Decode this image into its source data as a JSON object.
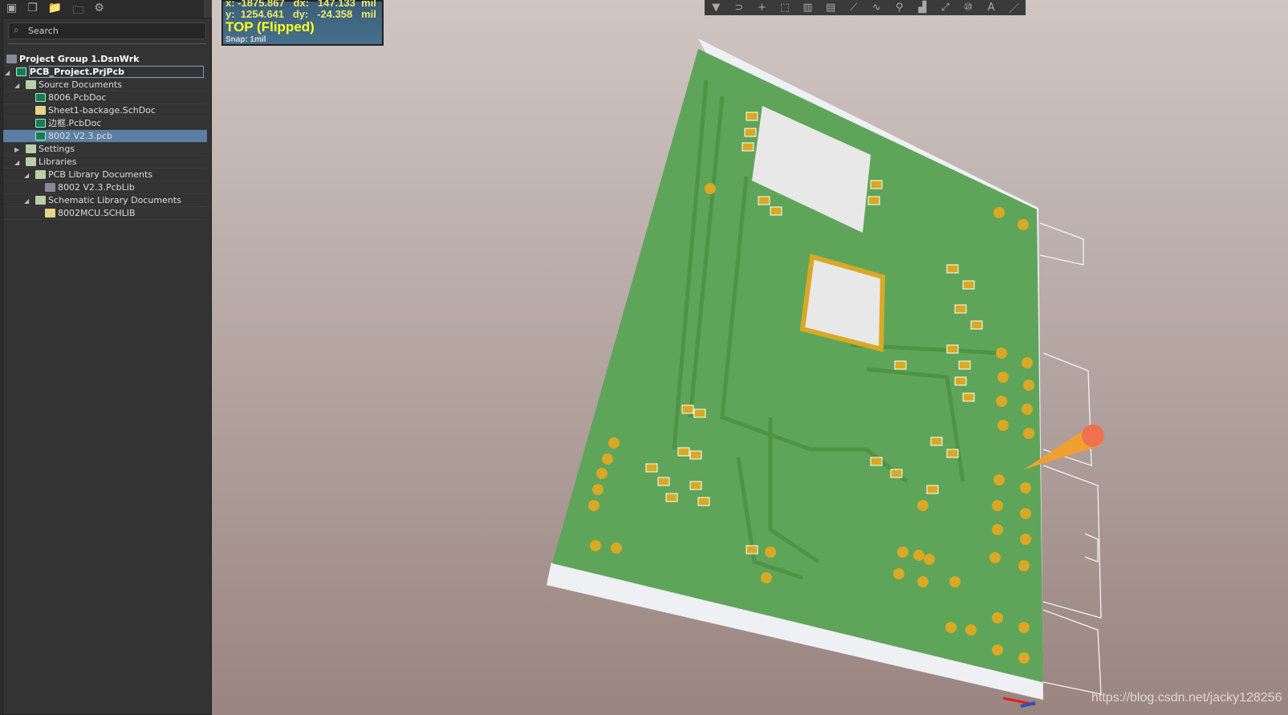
{
  "toolbar_left": {
    "icons": [
      "save-icon",
      "save-all-icon",
      "open-project-icon",
      "project-options-icon",
      "gear-icon"
    ]
  },
  "search": {
    "placeholder": "Search"
  },
  "tree": [
    {
      "label": "Project Group 1.DsnWrk",
      "level": 0,
      "icon": "workspace",
      "bold": true
    },
    {
      "label": "PCB_Project.PrjPcb",
      "level": 1,
      "icon": "pcb",
      "bold": true,
      "expanded": true,
      "focused": true
    },
    {
      "label": "Source Documents",
      "level": 2,
      "icon": "folder",
      "expanded": true
    },
    {
      "label": "8006.PcbDoc",
      "level": 3,
      "icon": "pcb"
    },
    {
      "label": "Sheet1-backage.SchDoc",
      "level": 3,
      "icon": "sch"
    },
    {
      "label": "边框.PcbDoc",
      "level": 3,
      "icon": "pcb"
    },
    {
      "label": "8002 V2.3.pcb",
      "level": 3,
      "icon": "pcb",
      "selected": true
    },
    {
      "label": "Settings",
      "level": 2,
      "icon": "folder",
      "expanded": false
    },
    {
      "label": "Libraries",
      "level": 2,
      "icon": "folder",
      "expanded": true
    },
    {
      "label": "PCB Library Documents",
      "level": 3,
      "icon": "folder",
      "expanded": true
    },
    {
      "label": "8002 V2.3.PcbLib",
      "level": 4,
      "icon": "lib"
    },
    {
      "label": "Schematic Library Documents",
      "level": 3,
      "icon": "folder",
      "expanded": true
    },
    {
      "label": "8002MCU.SCHLIB",
      "level": 4,
      "icon": "sch"
    }
  ],
  "info": {
    "x_line": "x: -1875.867   dx:   147.133  mil",
    "y_line": "y:  1254.641   dy:   -24.358   mil",
    "layer": "TOP (Flipped)",
    "snap": "Snap: 1mil"
  },
  "toolbar_main": {
    "icons": [
      "filter-icon",
      "magnet-icon",
      "cross-icon",
      "select-rect-icon",
      "chart-icon",
      "component-icon",
      "route-icon",
      "diff-pair-icon",
      "via-icon",
      "polygon-icon",
      "line-icon",
      "string-icon",
      "text-icon",
      "draw-line-icon"
    ]
  },
  "board": {
    "color": "#5ea55a",
    "pad_color": "#d9a825"
  },
  "watermark": "https://blog.csdn.net/jacky128256"
}
